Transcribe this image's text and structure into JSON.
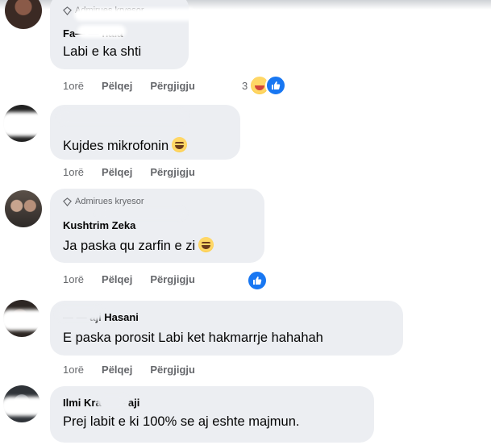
{
  "comments": [
    {
      "badge": "Admirues kryesor",
      "author": "Fa— — nala",
      "text": "Labi e ka shti",
      "time": "1orë",
      "like": "Pëlqej",
      "reply": "Përgjigju",
      "reaction_count": "3"
    },
    {
      "text": "Kujdes mikrofonin",
      "time": "1orë",
      "like": "Pëlqej",
      "reply": "Përgjigju"
    },
    {
      "badge": "Admirues kryesor",
      "author": "Kushtrim Zeka",
      "text": "Ja paska qu zarfin e zi",
      "time": "1orë",
      "like": "Pëlqej",
      "reply": "Përgjigju"
    },
    {
      "author": "— — aji Hasani",
      "text": "E paska porosit Labi ket hakmarrje hahahah",
      "time": "1orë",
      "like": "Pëlqej",
      "reply": "Përgjigju"
    },
    {
      "author": "Ilmi Kra— — aji",
      "text": "Prej labit e ki 100% se aj eshte majmun."
    }
  ],
  "icons": {
    "badge_icon": "diamond-icon",
    "reaction_haha": "haha-reaction-icon",
    "reaction_like": "like-reaction-icon",
    "emoji_laugh": "grinning-emoji-icon",
    "emoji_tears": "tears-of-joy-emoji-icon"
  },
  "colors": {
    "bubble": "#eceef2",
    "meta_text": "#65676b",
    "like_blue": "#1877f2"
  }
}
